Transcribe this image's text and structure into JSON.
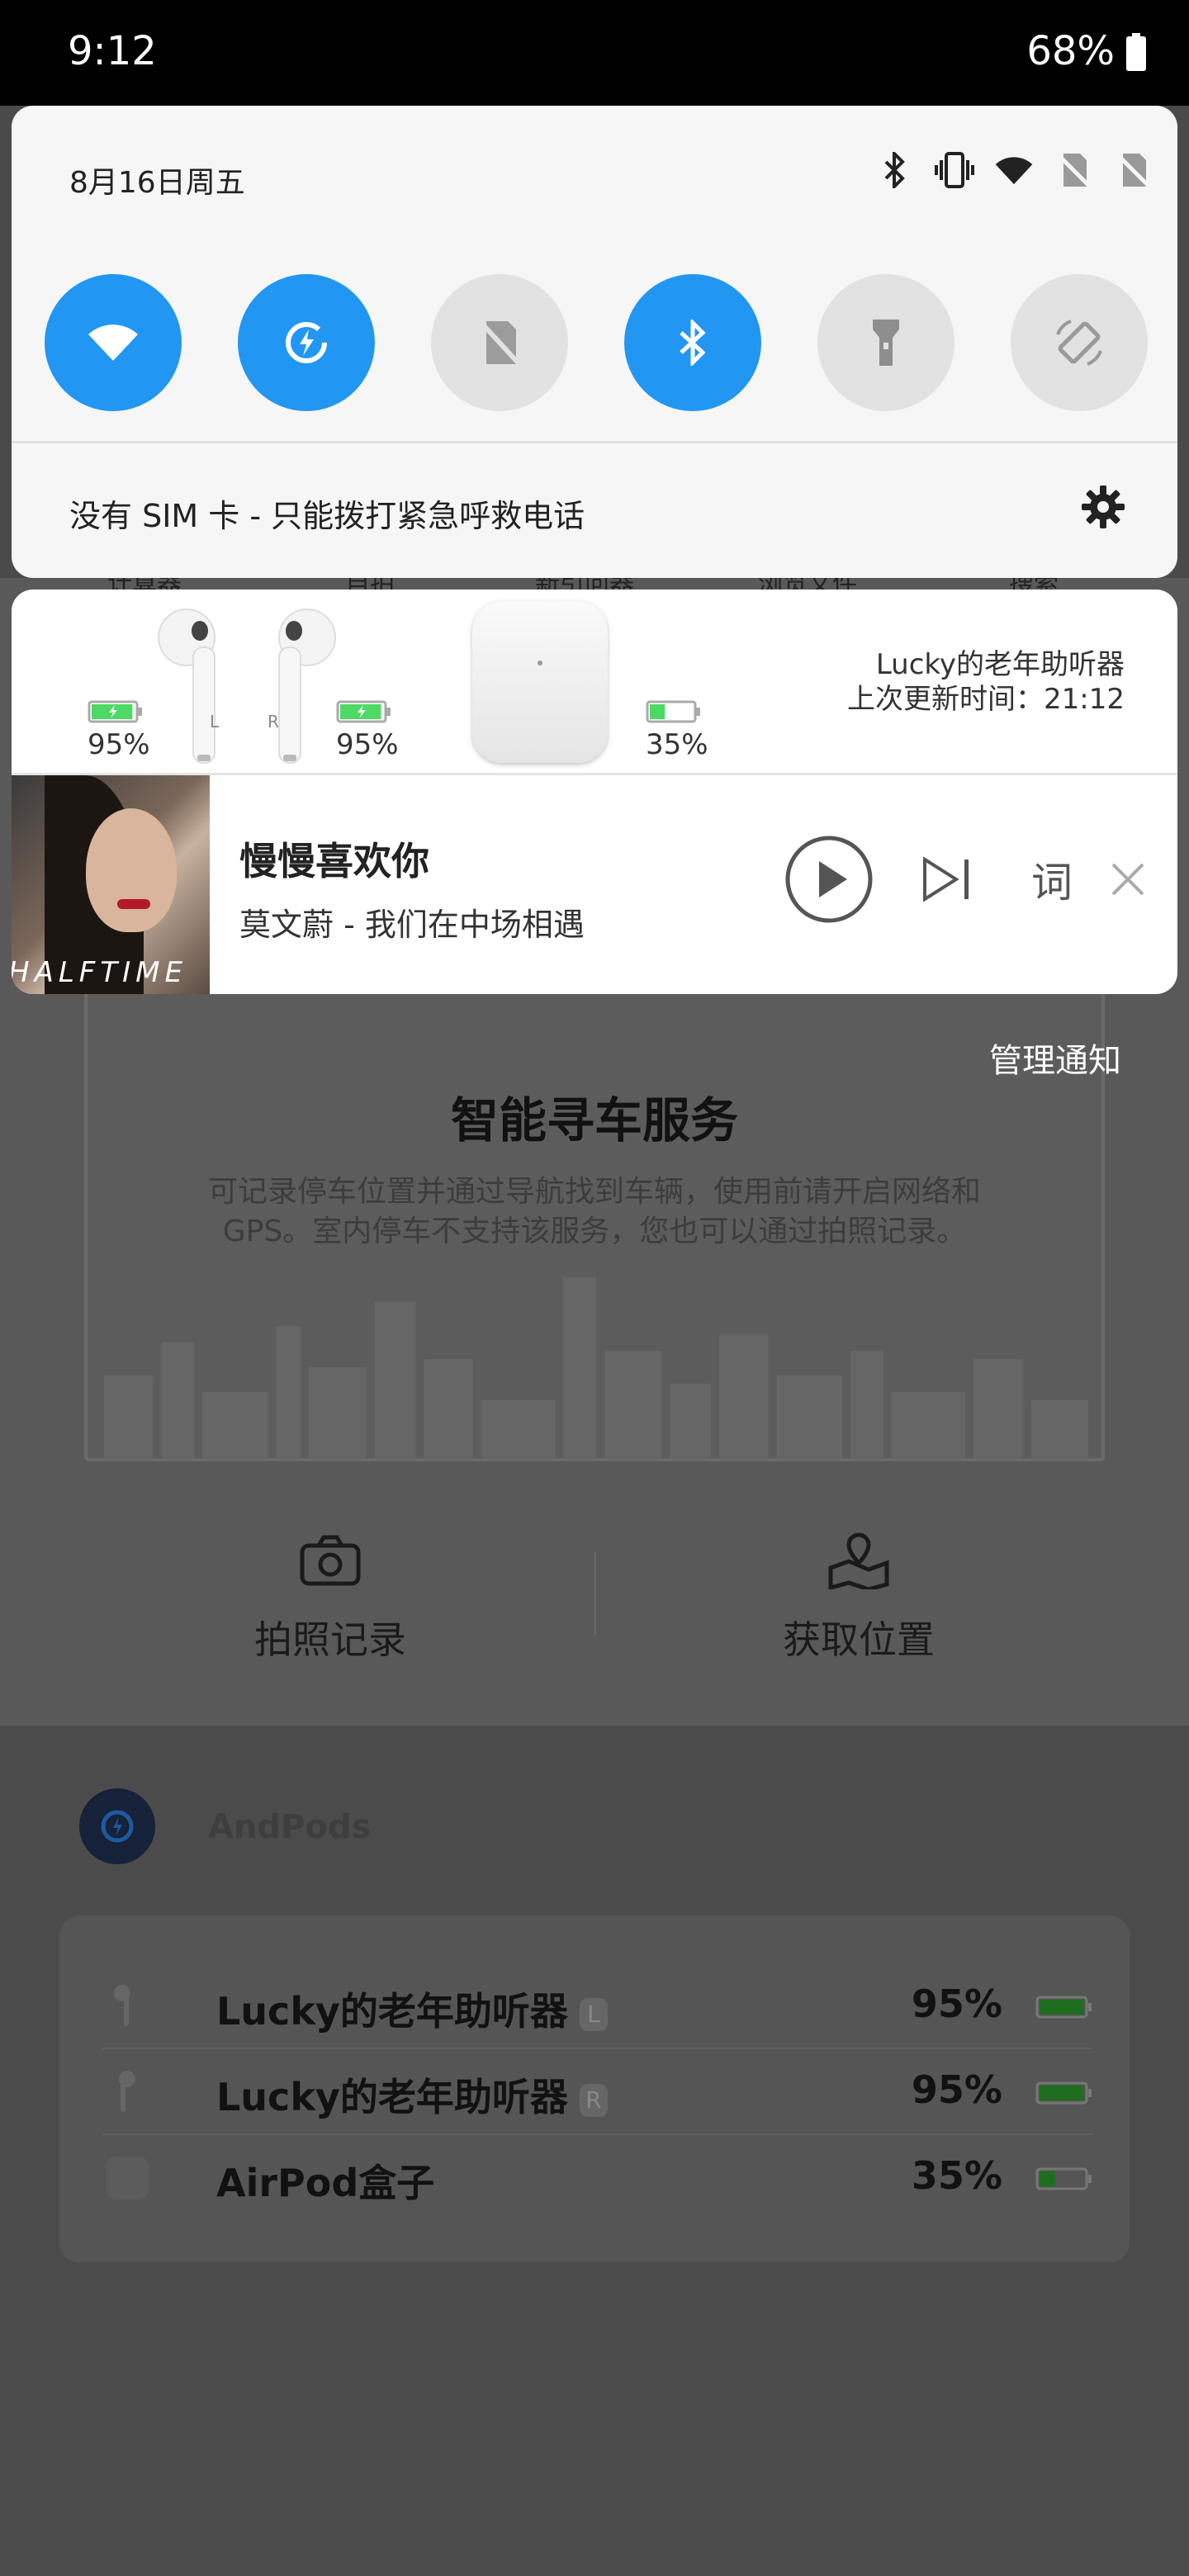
{
  "status_bar": {
    "time": "9:12",
    "battery": "68%"
  },
  "quick_settings": {
    "date": "8月16日周五",
    "status_icons": [
      "bluetooth-icon",
      "vibrate-icon",
      "wifi-signal-icon",
      "no-sim-icon",
      "no-sim-icon"
    ],
    "tiles": [
      {
        "name": "wifi",
        "state": "on"
      },
      {
        "name": "data-saver",
        "state": "on"
      },
      {
        "name": "mobile-data",
        "state": "off"
      },
      {
        "name": "bluetooth",
        "state": "on"
      },
      {
        "name": "flashlight",
        "state": "off"
      },
      {
        "name": "auto-rotate",
        "state": "off"
      }
    ],
    "sim_message": "没有 SIM 卡 - 只能拨打紧急呼救电话"
  },
  "airpods": {
    "left_pct": "95%",
    "right_pct": "95%",
    "case_pct": "35%",
    "left_label": "L",
    "right_label": "R",
    "left_level": 0.95,
    "right_level": 0.95,
    "case_level": 0.35,
    "device_name": "Lucky的老年助听器",
    "last_update": "上次更新时间：21:12"
  },
  "music": {
    "title": "慢慢喜欢你",
    "artist": "莫文蔚 - 我们在中场相遇",
    "album_text": "HALFTIME",
    "lyric_btn": "词"
  },
  "manage_notifications": "管理通知",
  "background": {
    "tabs": [
      "计算器",
      "自拍",
      "新引问器",
      "浏览文件",
      "搜索"
    ],
    "title": "智能寻车服务",
    "desc": "可记录停车位置并通过导航找到车辆，使用前请开启网络和GPS。室内停车不支持该服务，您也可以通过拍照记录。",
    "action_photo": "拍照记录",
    "action_location": "获取位置",
    "app_name": "AndPods",
    "devices": [
      {
        "name": "Lucky的老年助听器",
        "tag": "L",
        "pct": "95%"
      },
      {
        "name": "Lucky的老年助听器",
        "tag": "R",
        "pct": "95%"
      },
      {
        "name": "AirPod盒子",
        "tag": "",
        "pct": "35%"
      }
    ]
  },
  "colors": {
    "accent": "#2196f3",
    "battery_green": "#4cd964"
  }
}
